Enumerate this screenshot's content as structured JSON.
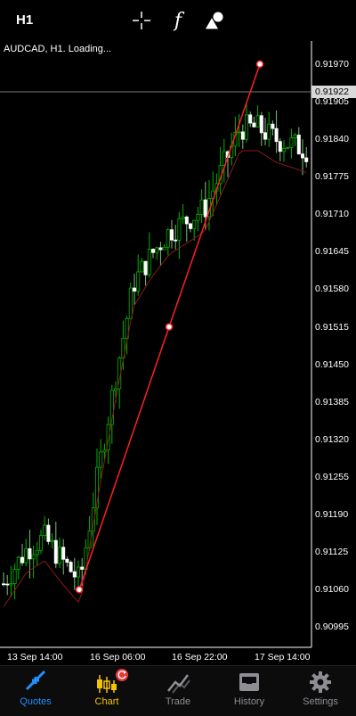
{
  "toolbar": {
    "timeframe": "H1",
    "crosshair_icon": "crosshair-icon",
    "indicators_icon": "function-icon",
    "objects_icon": "shapes-icon"
  },
  "chart": {
    "title": "AUDCAD, H1. Loading...",
    "current_price": "0.91922",
    "price_scale": [
      "0.91970",
      "0.91905",
      "0.91840",
      "0.91775",
      "0.91710",
      "0.91645",
      "0.91580",
      "0.91515",
      "0.91450",
      "0.91385",
      "0.91320",
      "0.91255",
      "0.91190",
      "0.91125",
      "0.91060",
      "0.90995"
    ],
    "time_scale": [
      "13 Sep 14:00",
      "16 Sep 06:00",
      "16 Sep 22:00",
      "17 Sep 14:00"
    ],
    "colors": {
      "up": "#00b300",
      "down": "#ffffff",
      "trendline": "#ff2020",
      "ma": "#8b1a1a"
    }
  },
  "chart_data": {
    "type": "line",
    "title": "",
    "symbol": "AUDCAD",
    "timeframe": "H1",
    "x": [
      "13 Sep 14:00",
      "16 Sep 06:00",
      "16 Sep 22:00",
      "17 Sep 14:00"
    ],
    "ylim": [
      0.9096,
      0.9201
    ],
    "series": [
      {
        "values": [
          0.9106,
          0.91515,
          0.9197
        ]
      }
    ],
    "current_price": 0.91922,
    "grid": false
  },
  "tabs": [
    {
      "label": "Quotes",
      "icon": "quotes-icon",
      "active": false,
      "color": "#1e90ff"
    },
    {
      "label": "Chart",
      "icon": "chart-icon",
      "active": true,
      "color": "#f5c400"
    },
    {
      "label": "Trade",
      "icon": "trade-icon",
      "active": false,
      "color": "#8e8e93"
    },
    {
      "label": "History",
      "icon": "history-icon",
      "active": false,
      "color": "#8e8e93"
    },
    {
      "label": "Settings",
      "icon": "gear-icon",
      "active": false,
      "color": "#8e8e93"
    }
  ]
}
